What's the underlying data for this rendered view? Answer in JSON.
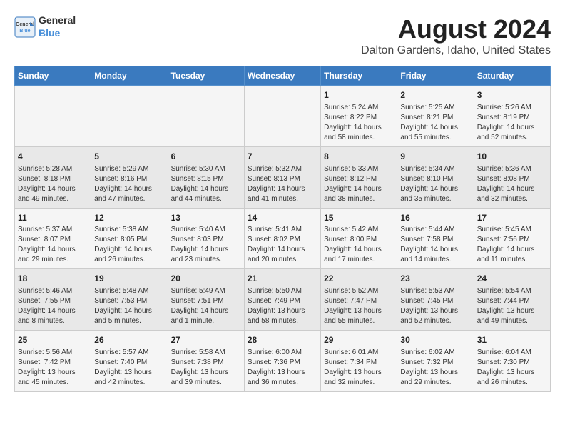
{
  "logo": {
    "general": "General",
    "blue": "Blue"
  },
  "header": {
    "title": "August 2024",
    "subtitle": "Dalton Gardens, Idaho, United States"
  },
  "weekdays": [
    "Sunday",
    "Monday",
    "Tuesday",
    "Wednesday",
    "Thursday",
    "Friday",
    "Saturday"
  ],
  "weeks": [
    [
      {
        "day": "",
        "info": ""
      },
      {
        "day": "",
        "info": ""
      },
      {
        "day": "",
        "info": ""
      },
      {
        "day": "",
        "info": ""
      },
      {
        "day": "1",
        "info": "Sunrise: 5:24 AM\nSunset: 8:22 PM\nDaylight: 14 hours\nand 58 minutes."
      },
      {
        "day": "2",
        "info": "Sunrise: 5:25 AM\nSunset: 8:21 PM\nDaylight: 14 hours\nand 55 minutes."
      },
      {
        "day": "3",
        "info": "Sunrise: 5:26 AM\nSunset: 8:19 PM\nDaylight: 14 hours\nand 52 minutes."
      }
    ],
    [
      {
        "day": "4",
        "info": "Sunrise: 5:28 AM\nSunset: 8:18 PM\nDaylight: 14 hours\nand 49 minutes."
      },
      {
        "day": "5",
        "info": "Sunrise: 5:29 AM\nSunset: 8:16 PM\nDaylight: 14 hours\nand 47 minutes."
      },
      {
        "day": "6",
        "info": "Sunrise: 5:30 AM\nSunset: 8:15 PM\nDaylight: 14 hours\nand 44 minutes."
      },
      {
        "day": "7",
        "info": "Sunrise: 5:32 AM\nSunset: 8:13 PM\nDaylight: 14 hours\nand 41 minutes."
      },
      {
        "day": "8",
        "info": "Sunrise: 5:33 AM\nSunset: 8:12 PM\nDaylight: 14 hours\nand 38 minutes."
      },
      {
        "day": "9",
        "info": "Sunrise: 5:34 AM\nSunset: 8:10 PM\nDaylight: 14 hours\nand 35 minutes."
      },
      {
        "day": "10",
        "info": "Sunrise: 5:36 AM\nSunset: 8:08 PM\nDaylight: 14 hours\nand 32 minutes."
      }
    ],
    [
      {
        "day": "11",
        "info": "Sunrise: 5:37 AM\nSunset: 8:07 PM\nDaylight: 14 hours\nand 29 minutes."
      },
      {
        "day": "12",
        "info": "Sunrise: 5:38 AM\nSunset: 8:05 PM\nDaylight: 14 hours\nand 26 minutes."
      },
      {
        "day": "13",
        "info": "Sunrise: 5:40 AM\nSunset: 8:03 PM\nDaylight: 14 hours\nand 23 minutes."
      },
      {
        "day": "14",
        "info": "Sunrise: 5:41 AM\nSunset: 8:02 PM\nDaylight: 14 hours\nand 20 minutes."
      },
      {
        "day": "15",
        "info": "Sunrise: 5:42 AM\nSunset: 8:00 PM\nDaylight: 14 hours\nand 17 minutes."
      },
      {
        "day": "16",
        "info": "Sunrise: 5:44 AM\nSunset: 7:58 PM\nDaylight: 14 hours\nand 14 minutes."
      },
      {
        "day": "17",
        "info": "Sunrise: 5:45 AM\nSunset: 7:56 PM\nDaylight: 14 hours\nand 11 minutes."
      }
    ],
    [
      {
        "day": "18",
        "info": "Sunrise: 5:46 AM\nSunset: 7:55 PM\nDaylight: 14 hours\nand 8 minutes."
      },
      {
        "day": "19",
        "info": "Sunrise: 5:48 AM\nSunset: 7:53 PM\nDaylight: 14 hours\nand 5 minutes."
      },
      {
        "day": "20",
        "info": "Sunrise: 5:49 AM\nSunset: 7:51 PM\nDaylight: 14 hours\nand 1 minute."
      },
      {
        "day": "21",
        "info": "Sunrise: 5:50 AM\nSunset: 7:49 PM\nDaylight: 13 hours\nand 58 minutes."
      },
      {
        "day": "22",
        "info": "Sunrise: 5:52 AM\nSunset: 7:47 PM\nDaylight: 13 hours\nand 55 minutes."
      },
      {
        "day": "23",
        "info": "Sunrise: 5:53 AM\nSunset: 7:45 PM\nDaylight: 13 hours\nand 52 minutes."
      },
      {
        "day": "24",
        "info": "Sunrise: 5:54 AM\nSunset: 7:44 PM\nDaylight: 13 hours\nand 49 minutes."
      }
    ],
    [
      {
        "day": "25",
        "info": "Sunrise: 5:56 AM\nSunset: 7:42 PM\nDaylight: 13 hours\nand 45 minutes."
      },
      {
        "day": "26",
        "info": "Sunrise: 5:57 AM\nSunset: 7:40 PM\nDaylight: 13 hours\nand 42 minutes."
      },
      {
        "day": "27",
        "info": "Sunrise: 5:58 AM\nSunset: 7:38 PM\nDaylight: 13 hours\nand 39 minutes."
      },
      {
        "day": "28",
        "info": "Sunrise: 6:00 AM\nSunset: 7:36 PM\nDaylight: 13 hours\nand 36 minutes."
      },
      {
        "day": "29",
        "info": "Sunrise: 6:01 AM\nSunset: 7:34 PM\nDaylight: 13 hours\nand 32 minutes."
      },
      {
        "day": "30",
        "info": "Sunrise: 6:02 AM\nSunset: 7:32 PM\nDaylight: 13 hours\nand 29 minutes."
      },
      {
        "day": "31",
        "info": "Sunrise: 6:04 AM\nSunset: 7:30 PM\nDaylight: 13 hours\nand 26 minutes."
      }
    ]
  ]
}
